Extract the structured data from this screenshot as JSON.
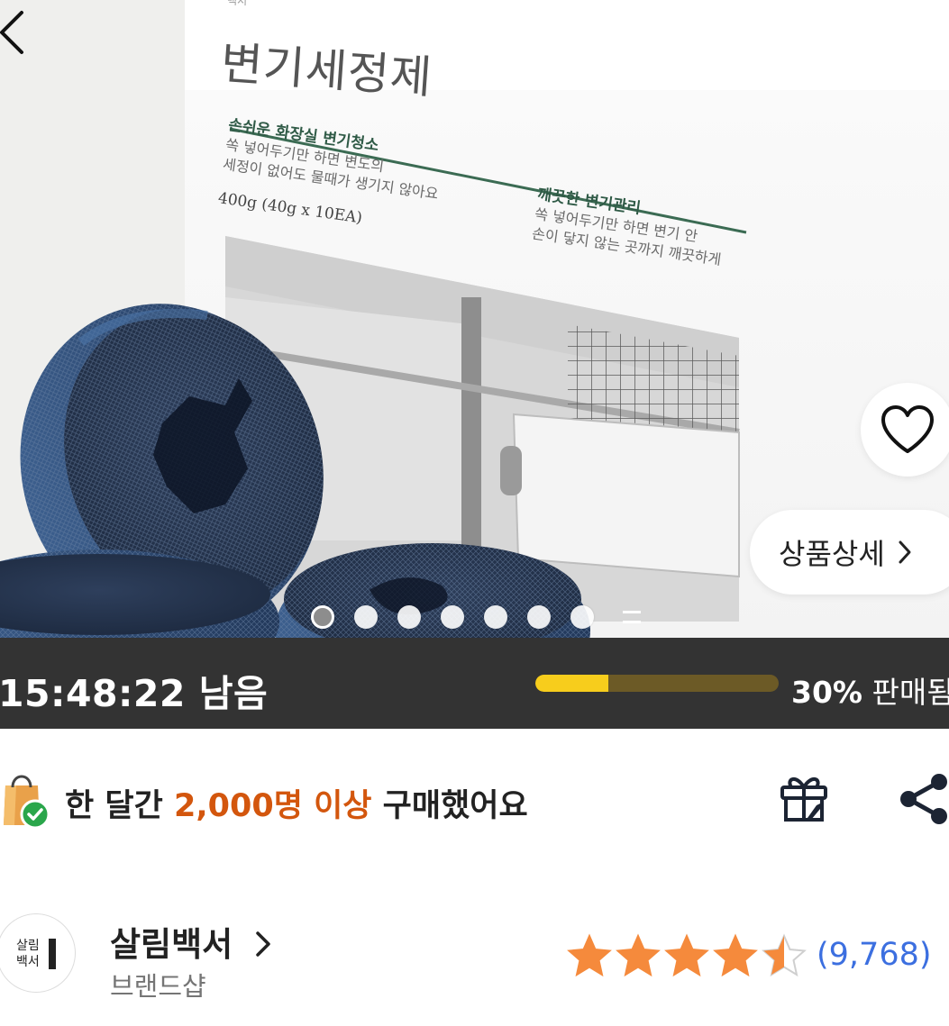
{
  "hero": {
    "package": {
      "brand_mark": "백서",
      "title": "변기세정제",
      "left_heading": "손쉬운 화장실 변기청소",
      "left_line1": "쏙 넣어두기만 하면 변도의",
      "left_line2": "세정이 없어도 물때가 생기지 않아요",
      "weight": "400g (40g x 10EA)",
      "right_heading": "깨끗한 변기관리",
      "right_line1": "쏙 넣어두기만 하면 변기 안",
      "right_line2": "손이 닿지 않는 곳까지 깨끗하게"
    },
    "detail_button_label": "상품상세",
    "carousel": {
      "total_dots": 7,
      "active_index": 0
    }
  },
  "timer": {
    "remaining": "15:48:22 남음",
    "sold_percent": 30,
    "sold_percent_label": "30%",
    "sold_suffix": "판매됨",
    "accent_color": "#f7cd1c"
  },
  "purchase": {
    "prefix": "한 달간",
    "highlight": "2,000명 이상",
    "suffix": "구매했어요",
    "highlight_color": "#d3560d"
  },
  "seller": {
    "logo_text_line1": "살림",
    "logo_text_line2": "백서",
    "name": "살림백서",
    "subtitle": "브랜드샵",
    "rating": 4.5,
    "review_count": "(9,768)",
    "star_color": "#f58a3c"
  },
  "icons": {
    "close": "chevron-left-icon",
    "wish": "heart-icon",
    "bag": "shopping-bag-check-icon",
    "gift": "gift-icon",
    "share": "share-icon"
  }
}
